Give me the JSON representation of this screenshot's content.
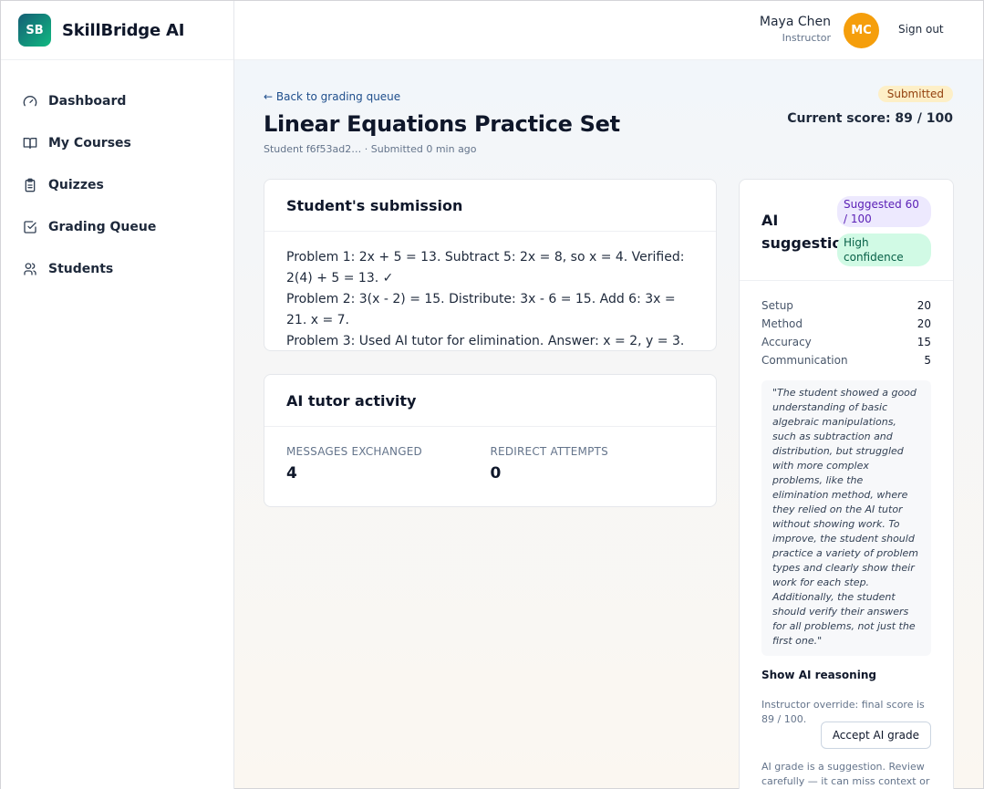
{
  "brand": {
    "logo": "SB",
    "name": "SkillBridge AI"
  },
  "nav": [
    {
      "label": "Dashboard",
      "icon": "gauge-icon"
    },
    {
      "label": "My Courses",
      "icon": "book-icon"
    },
    {
      "label": "Quizzes",
      "icon": "clipboard-icon"
    },
    {
      "label": "Grading Queue",
      "icon": "check-square-icon"
    },
    {
      "label": "Students",
      "icon": "users-icon"
    }
  ],
  "header": {
    "user_name": "Maya Chen",
    "user_role": "Instructor",
    "avatar_initials": "MC",
    "signout_label": "Sign out"
  },
  "page": {
    "back_link": "← Back to grading queue",
    "title": "Linear Equations Practice Set",
    "subtitle": "Student f6f53ad2… · Submitted 0 min ago",
    "status": "Submitted",
    "current_score": "Current score: 89 / 100"
  },
  "submission": {
    "heading": "Student's submission",
    "lines": [
      "Problem 1: 2x + 5 = 13. Subtract 5: 2x = 8, so x = 4. Verified: 2(4) + 5 = 13. ✓",
      "Problem 2: 3(x - 2) = 15. Distribute: 3x - 6 = 15. Add 6: 3x = 21. x = 7.",
      "Problem 3: Used AI tutor for elimination. Answer: x = 2, y = 3."
    ]
  },
  "tutor": {
    "heading": "AI tutor activity",
    "messages_label": "MESSAGES EXCHANGED",
    "messages_value": "4",
    "redirect_label": "REDIRECT ATTEMPTS",
    "redirect_value": "0"
  },
  "ai": {
    "title": "AI suggestion",
    "suggested": "Suggested 60 / 100",
    "confidence": "High confidence",
    "rubric": [
      {
        "name": "Setup",
        "points": "20"
      },
      {
        "name": "Method",
        "points": "20"
      },
      {
        "name": "Accuracy",
        "points": "15"
      },
      {
        "name": "Communication",
        "points": "5"
      }
    ],
    "feedback": "\"The student showed a good understanding of basic algebraic manipulations, such as subtraction and distribution, but struggled with more complex problems, like the elimination method, where they relied on the AI tutor without showing work. To improve, the student should practice a variety of problem types and clearly show their work for each step. Additionally, the student should verify their answers for all problems, not just the first one.\"",
    "show_reasoning": "Show AI reasoning",
    "override": "Instructor override: final score is 89 / 100.",
    "accept_label": "Accept AI grade",
    "disclaimer": "AI grade is a suggestion. Review carefully — it can miss context or"
  }
}
